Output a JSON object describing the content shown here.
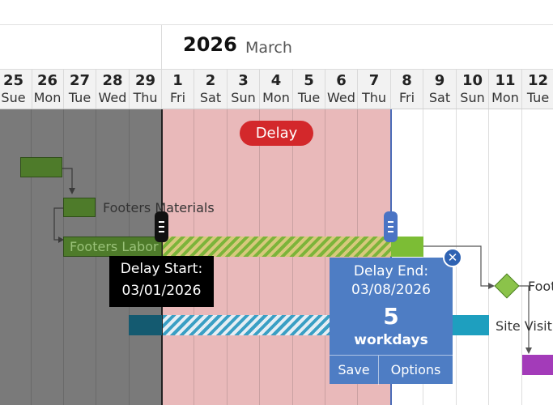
{
  "header": {
    "year": "2026",
    "month": "March"
  },
  "days": [
    {
      "num": "25",
      "weekday": "Sue"
    },
    {
      "num": "26",
      "weekday": "Mon"
    },
    {
      "num": "27",
      "weekday": "Tue"
    },
    {
      "num": "28",
      "weekday": "Wed"
    },
    {
      "num": "29",
      "weekday": "Thu"
    },
    {
      "num": "1",
      "weekday": "Fri"
    },
    {
      "num": "2",
      "weekday": "Sat"
    },
    {
      "num": "3",
      "weekday": "Sun"
    },
    {
      "num": "4",
      "weekday": "Mon"
    },
    {
      "num": "5",
      "weekday": "Tue"
    },
    {
      "num": "6",
      "weekday": "Wed"
    },
    {
      "num": "7",
      "weekday": "Thu"
    },
    {
      "num": "8",
      "weekday": "Fri"
    },
    {
      "num": "9",
      "weekday": "Sat"
    },
    {
      "num": "10",
      "weekday": "Sun"
    },
    {
      "num": "11",
      "weekday": "Mon"
    },
    {
      "num": "12",
      "weekday": "Tue"
    }
  ],
  "delay_badge": "Delay",
  "tasks": {
    "footers_materials": "Footers Materials",
    "footers_labor": "Footers Labor",
    "site_visit": "Site Visit",
    "footers_partial": "Foot"
  },
  "delay_start": {
    "label": "Delay Start:",
    "date": "03/01/2026"
  },
  "delay_end": {
    "label": "Delay End:",
    "date": "03/08/2026",
    "count": "5",
    "unit": "workdays",
    "save_label": "Save",
    "options_label": "Options"
  },
  "close_symbol": "✕",
  "colors": {
    "delay_badge": "#d3282b",
    "delay_region": "#e9b9ba",
    "popup": "#4e7dc4",
    "task_green": "#4e7b2a",
    "task_lime": "#7cbd35",
    "task_teal": "#145a70",
    "task_cyan": "#1e9fbf",
    "task_purple": "#a33bb9"
  }
}
